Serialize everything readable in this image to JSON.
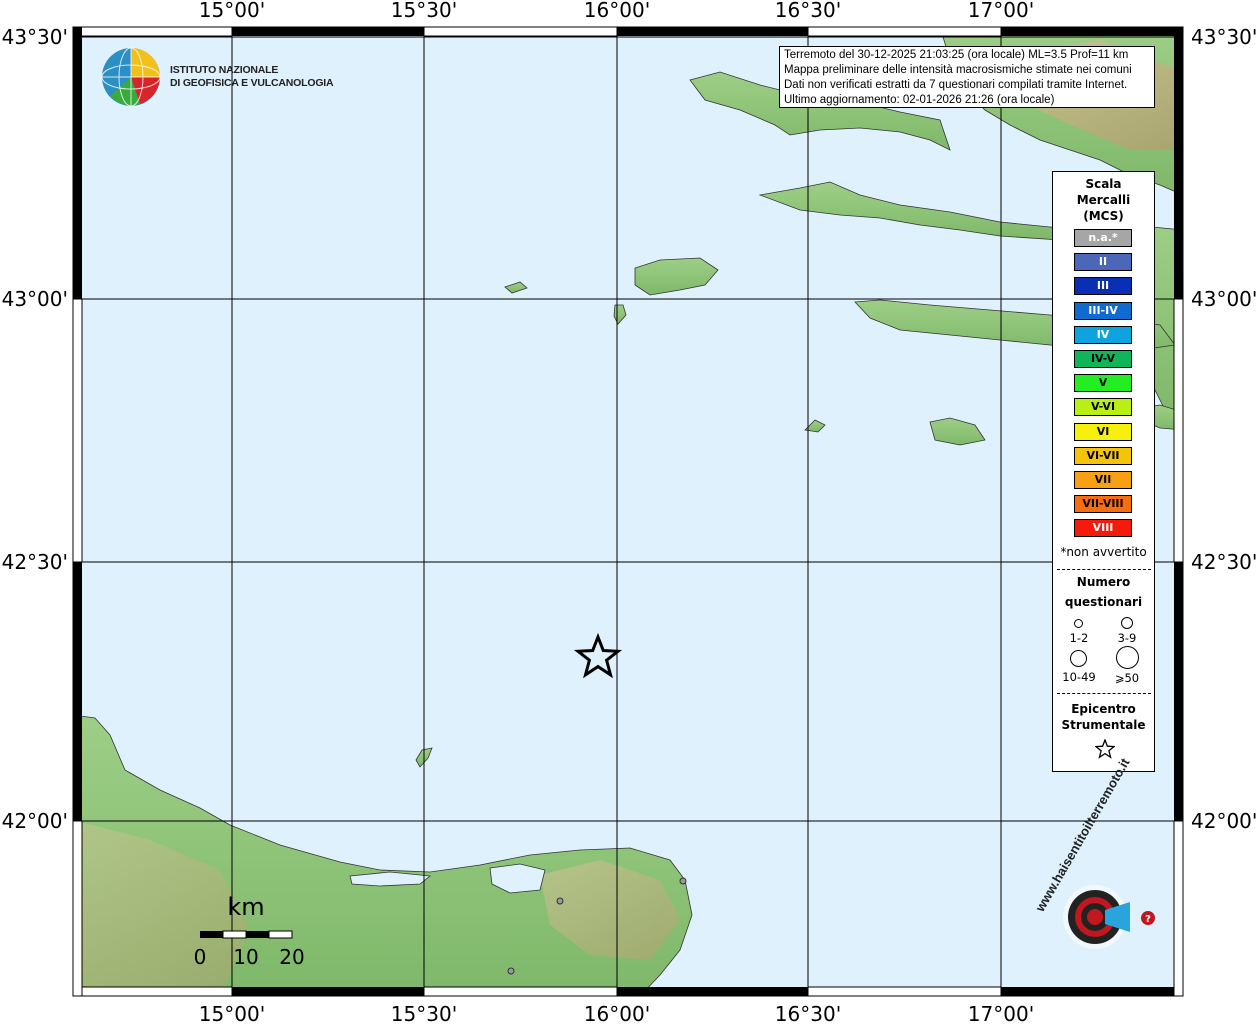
{
  "map": {
    "lon_labels": [
      "15°00'",
      "15°30'",
      "16°00'",
      "16°30'",
      "17°00'"
    ],
    "lat_labels": [
      "43°30'",
      "43°00'",
      "42°30'",
      "42°00'"
    ],
    "colors": {
      "sea": "#dff1fd",
      "land_low": "#8fc87a",
      "land_high": "#c9b48a",
      "grid": "#000000"
    }
  },
  "logo": {
    "line1": "ISTITUTO NAZIONALE",
    "line2": "DI GEOFISICA E VULCANOLOGIA",
    "icon": "ingv-globe-icon"
  },
  "info": {
    "line1": "Terremoto del 30-12-2025 21:03:25 (ora locale) ML=3.5 Prof=11 km",
    "line2": "Mappa preliminare delle intensità macrosismiche stimate nei comuni",
    "line3": "Dati non verificati estratti da 7 questionari compilati tramite Internet.",
    "line4": "Ultimo aggiornamento: 02-01-2026 21:26 (ora locale)"
  },
  "legend": {
    "title": [
      "Scala",
      "Mercalli",
      "(MCS)"
    ],
    "items": [
      {
        "label": "n.a.*",
        "color": "#a6a6a6",
        "text_color": "#ffffff"
      },
      {
        "label": "II",
        "color": "#4c66b8",
        "text_color": "#ffffff"
      },
      {
        "label": "III",
        "color": "#0a2fb5",
        "text_color": "#ffffff"
      },
      {
        "label": "III-IV",
        "color": "#0f6ad1",
        "text_color": "#ffffff"
      },
      {
        "label": "IV",
        "color": "#0ea3df",
        "text_color": "#ffffff"
      },
      {
        "label": "IV-V",
        "color": "#0fb556",
        "text_color": "#000000"
      },
      {
        "label": "V",
        "color": "#22ee22",
        "text_color": "#000000"
      },
      {
        "label": "V-VI",
        "color": "#b8f014",
        "text_color": "#000000"
      },
      {
        "label": "VI",
        "color": "#f7f00c",
        "text_color": "#000000"
      },
      {
        "label": "VI-VII",
        "color": "#f5c40a",
        "text_color": "#000000"
      },
      {
        "label": "VII",
        "color": "#f7a014",
        "text_color": "#000000"
      },
      {
        "label": "VII-VIII",
        "color": "#f76d0f",
        "text_color": "#000000"
      },
      {
        "label": "VIII",
        "color": "#f51a0a",
        "text_color": "#ffffff"
      }
    ],
    "note": "*non avvertito",
    "count_title": [
      "Numero",
      "questionari"
    ],
    "counts": [
      "1-2",
      "3-9",
      "10-49",
      "⩾50"
    ],
    "epicenter_title": [
      "Epicentro",
      "Strumentale"
    ],
    "epicenter_icon": "star-icon"
  },
  "scale": {
    "unit": "km",
    "labels": [
      "0",
      "10",
      "20"
    ]
  },
  "brand": {
    "text": "haisentitoilterremoto.it",
    "prefix": "www.",
    "icon": "haisentito-logo-icon"
  }
}
